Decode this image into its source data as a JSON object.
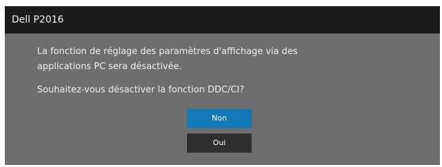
{
  "dialog": {
    "title": "Dell P2016",
    "message_line1": "La fonction de réglage des paramètres d'affichage via des",
    "message_line2": "applications PC sera désactivée.",
    "question": "Souhaitez-vous désactiver la fonction DDC/CI?",
    "buttons": {
      "non": "Non",
      "oui": "Oui"
    }
  },
  "colors": {
    "titlebar": "#1c1c1c",
    "body": "#6e6e6e",
    "selected_button": "#1479b8",
    "button": "#2f2f2f"
  }
}
